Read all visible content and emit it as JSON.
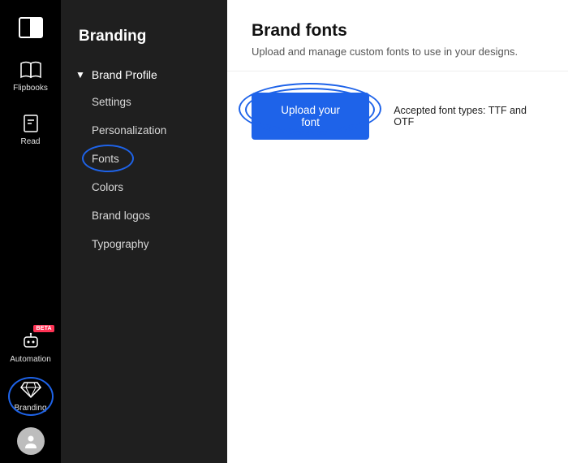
{
  "rail": {
    "items": [
      {
        "name": "logo",
        "label": "",
        "icon": "logo"
      },
      {
        "name": "flipbooks",
        "label": "Flipbooks",
        "icon": "book-open"
      },
      {
        "name": "read",
        "label": "Read",
        "icon": "page"
      },
      {
        "name": "automation",
        "label": "Automation",
        "icon": "bot",
        "badge": "BETA"
      },
      {
        "name": "branding",
        "label": "Branding",
        "icon": "diamond",
        "active": true
      }
    ]
  },
  "sidebar": {
    "title": "Branding",
    "group": {
      "label": "Brand Profile",
      "expanded": true,
      "items": [
        {
          "label": "Settings"
        },
        {
          "label": "Personalization"
        },
        {
          "label": "Fonts",
          "active": true
        },
        {
          "label": "Colors"
        },
        {
          "label": "Brand logos"
        },
        {
          "label": "Typography"
        }
      ]
    }
  },
  "main": {
    "title": "Brand fonts",
    "subtitle": "Upload and manage custom fonts to use in your designs.",
    "upload_label": "Upload your font",
    "accepted_label": "Accepted font types: TTF and OTF"
  },
  "colors": {
    "accent": "#1E63E9",
    "badge": "#ff3355"
  }
}
